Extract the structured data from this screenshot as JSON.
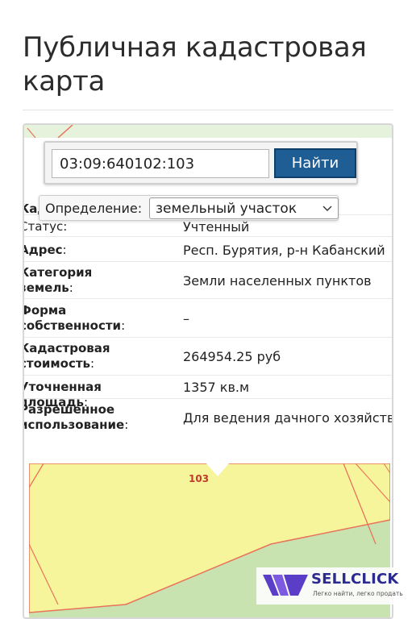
{
  "page": {
    "title_line1": "Публичная кадастровая",
    "title_line2": "карта"
  },
  "search": {
    "value": "03:09:640102:103",
    "button_label": "Найти"
  },
  "definition": {
    "label": "Определение:",
    "selected": "земельный участок"
  },
  "info_rows": [
    {
      "label": "Кад",
      "value": ""
    },
    {
      "label": "Статус",
      "value": "Учтенный"
    },
    {
      "label": "Адрес",
      "value": "Респ. Бурятия, р-н Кабанский"
    },
    {
      "label_line1": "Категория",
      "label_line2": "земель",
      "value": "Земли населенных пунктов"
    },
    {
      "label_line1": "Форма",
      "label_line2": "собственности",
      "value": "–"
    },
    {
      "label_line1": "Кадастровая",
      "label_line2": "стоимость",
      "value": "264954.25 руб"
    },
    {
      "label": "Уточненная площадь",
      "value": "1357 кв.м"
    },
    {
      "label_line1": "Разрешенное",
      "label_line2": "использование",
      "value": "Для ведения дачного хозяйства"
    }
  ],
  "map": {
    "plot_number": "103",
    "plot_fill": "#f7f59c",
    "outside_fill": "#c8e3b0",
    "boundary_color": "#e8735a"
  },
  "watermark": {
    "brand": "SELLCLICK",
    "tagline": "Легко найти, легко продать"
  },
  "colors": {
    "button": "#1f5e95",
    "brand": "#5b3ec8"
  }
}
